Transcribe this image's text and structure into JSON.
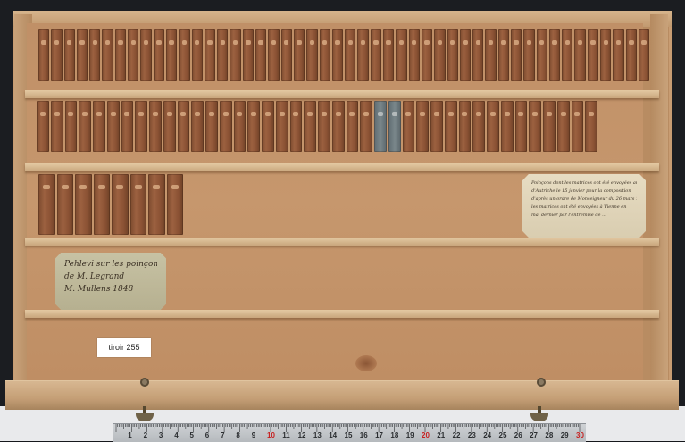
{
  "tag": {
    "text": "tiroir 255"
  },
  "label_right": {
    "lines": [
      "Poinçons dont les matrices ont été envoyées au gouvernement",
      "d'Autriche le 15 janvier pour la composition",
      "d'après un ordre de Monseigneur du 26 mars 1837",
      "les matrices ont été envoyées à Vienne en",
      "mai dernier par l'entremise de ..."
    ]
  },
  "label_left": {
    "lines": [
      "Pehlevi sur les poinçons",
      "de M. Legrand",
      "M. Mullens 1848"
    ]
  },
  "ruler": {
    "numbers": [
      "1",
      "2",
      "3",
      "4",
      "5",
      "6",
      "7",
      "8",
      "9",
      "10",
      "11",
      "12",
      "13",
      "14",
      "15",
      "16",
      "17",
      "18",
      "19",
      "20",
      "21",
      "22",
      "23",
      "24",
      "25",
      "26",
      "27",
      "28",
      "29",
      "30"
    ],
    "red_numbers": [
      "10",
      "20",
      "30"
    ]
  },
  "rows": {
    "row1_count": 48,
    "row2_count": 40,
    "row2_gray_positions": [
      24,
      25
    ],
    "row3_count": 8
  }
}
